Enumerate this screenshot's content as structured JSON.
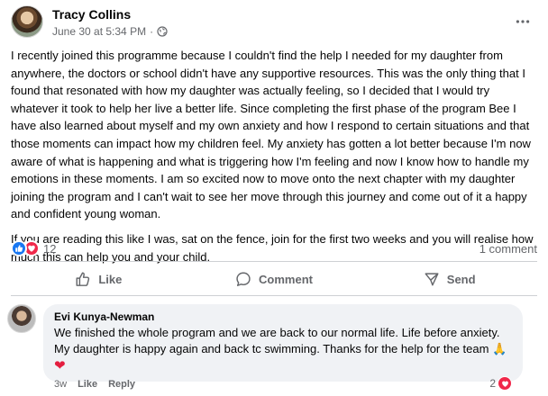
{
  "post": {
    "author": "Tracy Collins",
    "timestamp": "June 30 at 5:34 PM",
    "separator": "·",
    "paragraphs": [
      "I recently joined this programme because I couldn't find the help I needed for my daughter from anywhere, the doctors or school didn't have any supportive resources. This was the only thing that I found that resonated with how my daughter was actually feeling, so I decided that I would try whatever it took to help her live a better life. Since completing the first phase of the program Bee I have also learned about myself and my own anxiety and how I respond to certain situations and that those moments can impact how my children feel. My anxiety has gotten a lot better because I'm now aware of what is happening and what is triggering how I'm feeling and now I know how to handle my emotions in these moments. I am so excited now to move onto the next chapter with my daughter joining the program and I can't wait to see her move through this journey and come out of it a happy and confident young woman.",
      "If you are reading this like I was, sat on the fence, join for the first two weeks and you will realise how much this can help you and your child."
    ]
  },
  "reactions": {
    "count": "12",
    "comments": "1 comment"
  },
  "actions": {
    "like": "Like",
    "comment": "Comment",
    "send": "Send"
  },
  "comment": {
    "author": "Evi Kunya-Newman",
    "text": "We finished the whole program and we are back to our normal life. Life before anxiety. My daughter is happy again and back tc swimming. Thanks for the help for the team",
    "emoji": "🙏",
    "heart": "❤",
    "time": "3w",
    "like": "Like",
    "reply": "Reply",
    "reaction_count": "2"
  },
  "colors": {
    "like_blue": "#1877f2",
    "love_red": "#f0284a",
    "muted": "#65676b",
    "bubble": "#f0f2f5"
  },
  "icons": [
    "globe-icon",
    "more-icon",
    "like-reaction-icon",
    "love-reaction-icon",
    "thumbs-up-icon",
    "comment-icon",
    "send-icon",
    "heart-icon"
  ]
}
